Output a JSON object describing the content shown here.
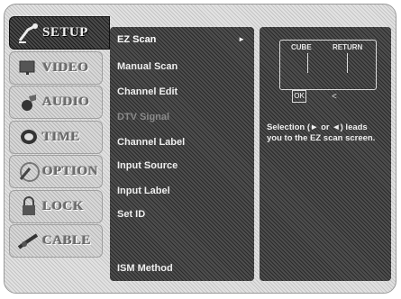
{
  "sidebar": {
    "items": [
      {
        "label": "SETUP",
        "icon": "satellite-dish-icon",
        "active": true
      },
      {
        "label": "VIDEO",
        "icon": "tv-icon",
        "active": false
      },
      {
        "label": "AUDIO",
        "icon": "speaker-icon",
        "active": false
      },
      {
        "label": "TIME",
        "icon": "clock-icon",
        "active": false
      },
      {
        "label": "OPTION",
        "icon": "option-ring-icon",
        "active": false
      },
      {
        "label": "LOCK",
        "icon": "padlock-icon",
        "active": false
      },
      {
        "label": "CABLE",
        "icon": "cable-plug-icon",
        "active": false
      }
    ]
  },
  "menu": {
    "items": [
      {
        "label": "EZ Scan",
        "state": "selected"
      },
      {
        "label": "Manual Scan",
        "state": "normal"
      },
      {
        "label": "Channel Edit",
        "state": "normal"
      },
      {
        "label": "DTV Signal",
        "state": "disabled"
      },
      {
        "label": "Channel Label",
        "state": "normal"
      },
      {
        "label": "Input Source",
        "state": "normal"
      },
      {
        "label": "Input Label",
        "state": "normal"
      },
      {
        "label": "Set ID",
        "state": "normal"
      },
      {
        "label": "ISM Method",
        "state": "normal"
      }
    ],
    "arrow": "►"
  },
  "info": {
    "remote_left": "CUBE",
    "remote_right": "RETURN",
    "ok_label": "OK",
    "description": "Selection (► or ◄) leads you to the EZ scan screen."
  }
}
